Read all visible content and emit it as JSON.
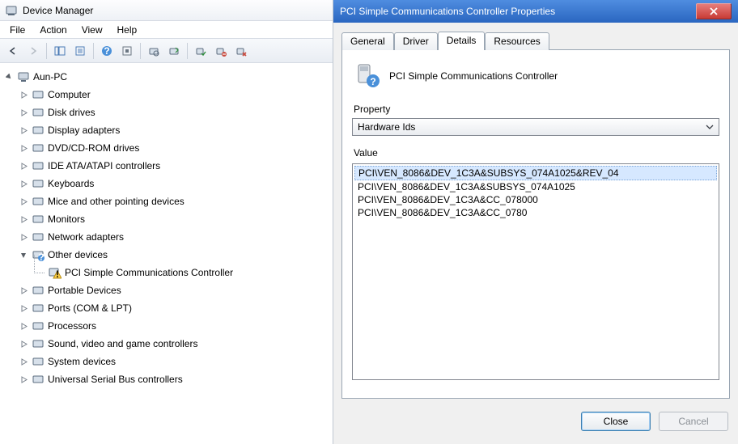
{
  "dm": {
    "title": "Device Manager",
    "menu": [
      "File",
      "Action",
      "View",
      "Help"
    ],
    "root": "Aun-PC",
    "nodes": [
      {
        "label": "Computer",
        "expandable": true
      },
      {
        "label": "Disk drives",
        "expandable": true
      },
      {
        "label": "Display adapters",
        "expandable": true
      },
      {
        "label": "DVD/CD-ROM drives",
        "expandable": true
      },
      {
        "label": "IDE ATA/ATAPI controllers",
        "expandable": true
      },
      {
        "label": "Keyboards",
        "expandable": true
      },
      {
        "label": "Mice and other pointing devices",
        "expandable": true
      },
      {
        "label": "Monitors",
        "expandable": true
      },
      {
        "label": "Network adapters",
        "expandable": true
      },
      {
        "label": "Other devices",
        "expandable": true,
        "expanded": true,
        "children": [
          {
            "label": "PCI Simple Communications Controller",
            "warn": true
          }
        ]
      },
      {
        "label": "Portable Devices",
        "expandable": true
      },
      {
        "label": "Ports (COM & LPT)",
        "expandable": true
      },
      {
        "label": "Processors",
        "expandable": true
      },
      {
        "label": "Sound, video and game controllers",
        "expandable": true
      },
      {
        "label": "System devices",
        "expandable": true
      },
      {
        "label": "Universal Serial Bus controllers",
        "expandable": true
      }
    ]
  },
  "prop": {
    "title": "PCI Simple Communications Controller Properties",
    "tabs": [
      "General",
      "Driver",
      "Details",
      "Resources"
    ],
    "active_tab": 2,
    "device_name": "PCI Simple Communications Controller",
    "property_label": "Property",
    "property_selected": "Hardware Ids",
    "value_label": "Value",
    "values": [
      "PCI\\VEN_8086&DEV_1C3A&SUBSYS_074A1025&REV_04",
      "PCI\\VEN_8086&DEV_1C3A&SUBSYS_074A1025",
      "PCI\\VEN_8086&DEV_1C3A&CC_078000",
      "PCI\\VEN_8086&DEV_1C3A&CC_0780"
    ],
    "selected_value_index": 0,
    "buttons": {
      "close": "Close",
      "cancel": "Cancel"
    }
  }
}
